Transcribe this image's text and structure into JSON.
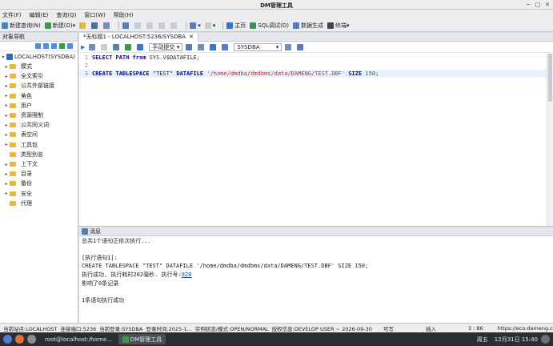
{
  "window": {
    "title": "DM管理工具",
    "minimize": "─",
    "maximize": "□",
    "close": "✕"
  },
  "menu": [
    "文件(F)",
    "编辑(E)",
    "查询(Q)",
    "窗口(W)",
    "帮助(H)"
  ],
  "toolbar": {
    "new_query": "新建查询(N)",
    "new": "新建(O)",
    "home": "主页",
    "sql_debug": "SQL调试(D)",
    "data_gen": "数据生成",
    "terminal": "终端"
  },
  "nav": {
    "title": "对象导航",
    "root": "LOCALHOST(SYSDBA)",
    "items": [
      {
        "label": "模式",
        "expandable": true
      },
      {
        "label": "全文索引",
        "expandable": true
      },
      {
        "label": "公共外部链接",
        "expandable": true
      },
      {
        "label": "角色",
        "expandable": true
      },
      {
        "label": "用户",
        "expandable": true
      },
      {
        "label": "资源限制",
        "expandable": true
      },
      {
        "label": "公共同义词",
        "expandable": true
      },
      {
        "label": "表空间",
        "expandable": true
      },
      {
        "label": "工具包",
        "expandable": true
      },
      {
        "label": "类型别名",
        "expandable": false
      },
      {
        "label": "上下文",
        "expandable": true
      },
      {
        "label": "目录",
        "expandable": true
      },
      {
        "label": "备份",
        "expandable": true
      },
      {
        "label": "安全",
        "expandable": true
      },
      {
        "label": "代理",
        "expandable": false
      }
    ]
  },
  "editor": {
    "tab_title": "*无标题1 - LOCALHOST:5236/SYSDBA",
    "commit_mode": "手动提交",
    "schema": "SYSDBA",
    "lines": [
      {
        "n": "1",
        "parts": [
          {
            "t": "SELECT PATH from",
            "c": "kw"
          },
          {
            "t": " SYS.V$DATAFILE;",
            "c": ""
          }
        ]
      },
      {
        "n": "2",
        "parts": []
      },
      {
        "n": "3",
        "parts": [
          {
            "t": "CREATE TABLESPACE",
            "c": "kw"
          },
          {
            "t": " \"TEST\" ",
            "c": ""
          },
          {
            "t": "DATAFILE",
            "c": "kw"
          },
          {
            "t": " ",
            "c": ""
          },
          {
            "t": "'/home/dmdba/dmdbms/data/DAMENG/TEST.DBF'",
            "c": "str"
          },
          {
            "t": " ",
            "c": ""
          },
          {
            "t": "SIZE",
            "c": "kw"
          },
          {
            "t": " ",
            "c": ""
          },
          {
            "t": "150",
            "c": "num"
          },
          {
            "t": ";",
            "c": ""
          }
        ]
      }
    ]
  },
  "messages": {
    "title": "消息",
    "lines": [
      "总共1个语句正依次执行...",
      "",
      "[执行语句1]:",
      "CREATE TABLESPACE \"TEST\" DATAFILE '/home/dmdba/dmdbms/data/DAMENG/TEST.DBF' SIZE 150;",
      "执行成功, 执行耗时202毫秒. 执行号:",
      "影响了0条记录",
      "",
      "1条语句执行成功"
    ],
    "exec_no": "828"
  },
  "status": {
    "site": "当前站点:LOCALHOST",
    "port": "连接端口:5236",
    "login": "当前登录:SYSDBA",
    "login_time": "登录时间:2025-1...",
    "instance": "实例状态/模式:OPEN/NORMAL",
    "license": "授权信息:DEVELOP USER ~ 2026-09-30",
    "writable": "可写",
    "insert": "插入",
    "cursor": "3 : 86",
    "url": "https://eco.dameng.com"
  },
  "taskbar": {
    "terminal": "root@localhost:/home...",
    "app": "DM管理工具",
    "day": "周五",
    "date": "12月31日 15:40"
  }
}
